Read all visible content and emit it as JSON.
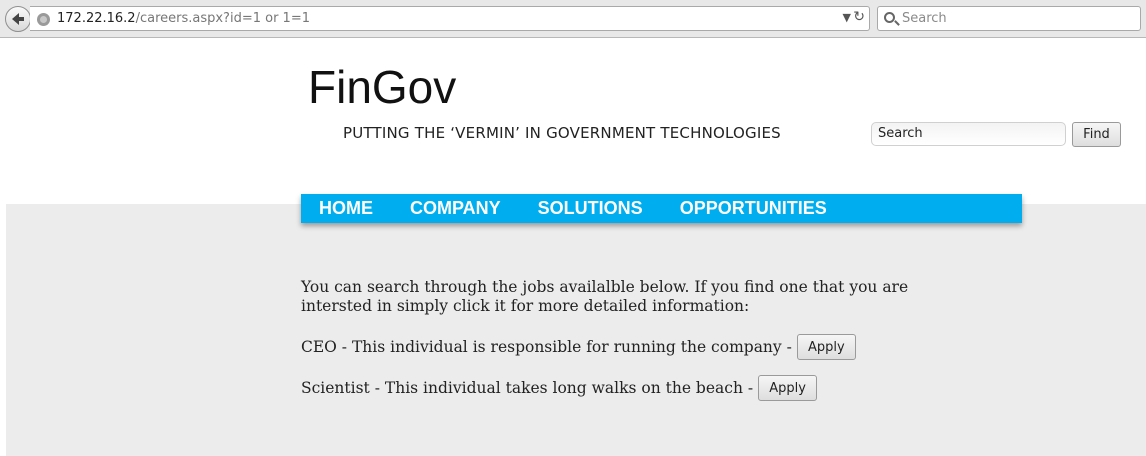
{
  "browser": {
    "url_host": "172.22.16.2",
    "url_path": "/careers.aspx?id=1 or 1=1",
    "search_placeholder": "Search"
  },
  "site": {
    "brand": "FinGov",
    "tagline": "PUTTING THE ‘VERMIN’ IN GOVERNMENT TECHNOLOGIES",
    "search_value": "Search",
    "find_label": "Find"
  },
  "nav": {
    "items": [
      "HOME",
      "COMPANY",
      "SOLUTIONS",
      "OPPORTUNITIES"
    ]
  },
  "content": {
    "intro": "You can search through the jobs availalble below. If you find one that you are intersted in simply click it for more detailed information:",
    "jobs": [
      {
        "text": "CEO - This individual is responsible for running the company -",
        "button": "Apply"
      },
      {
        "text": "Scientist - This individual takes long walks on the beach -",
        "button": "Apply"
      }
    ]
  }
}
